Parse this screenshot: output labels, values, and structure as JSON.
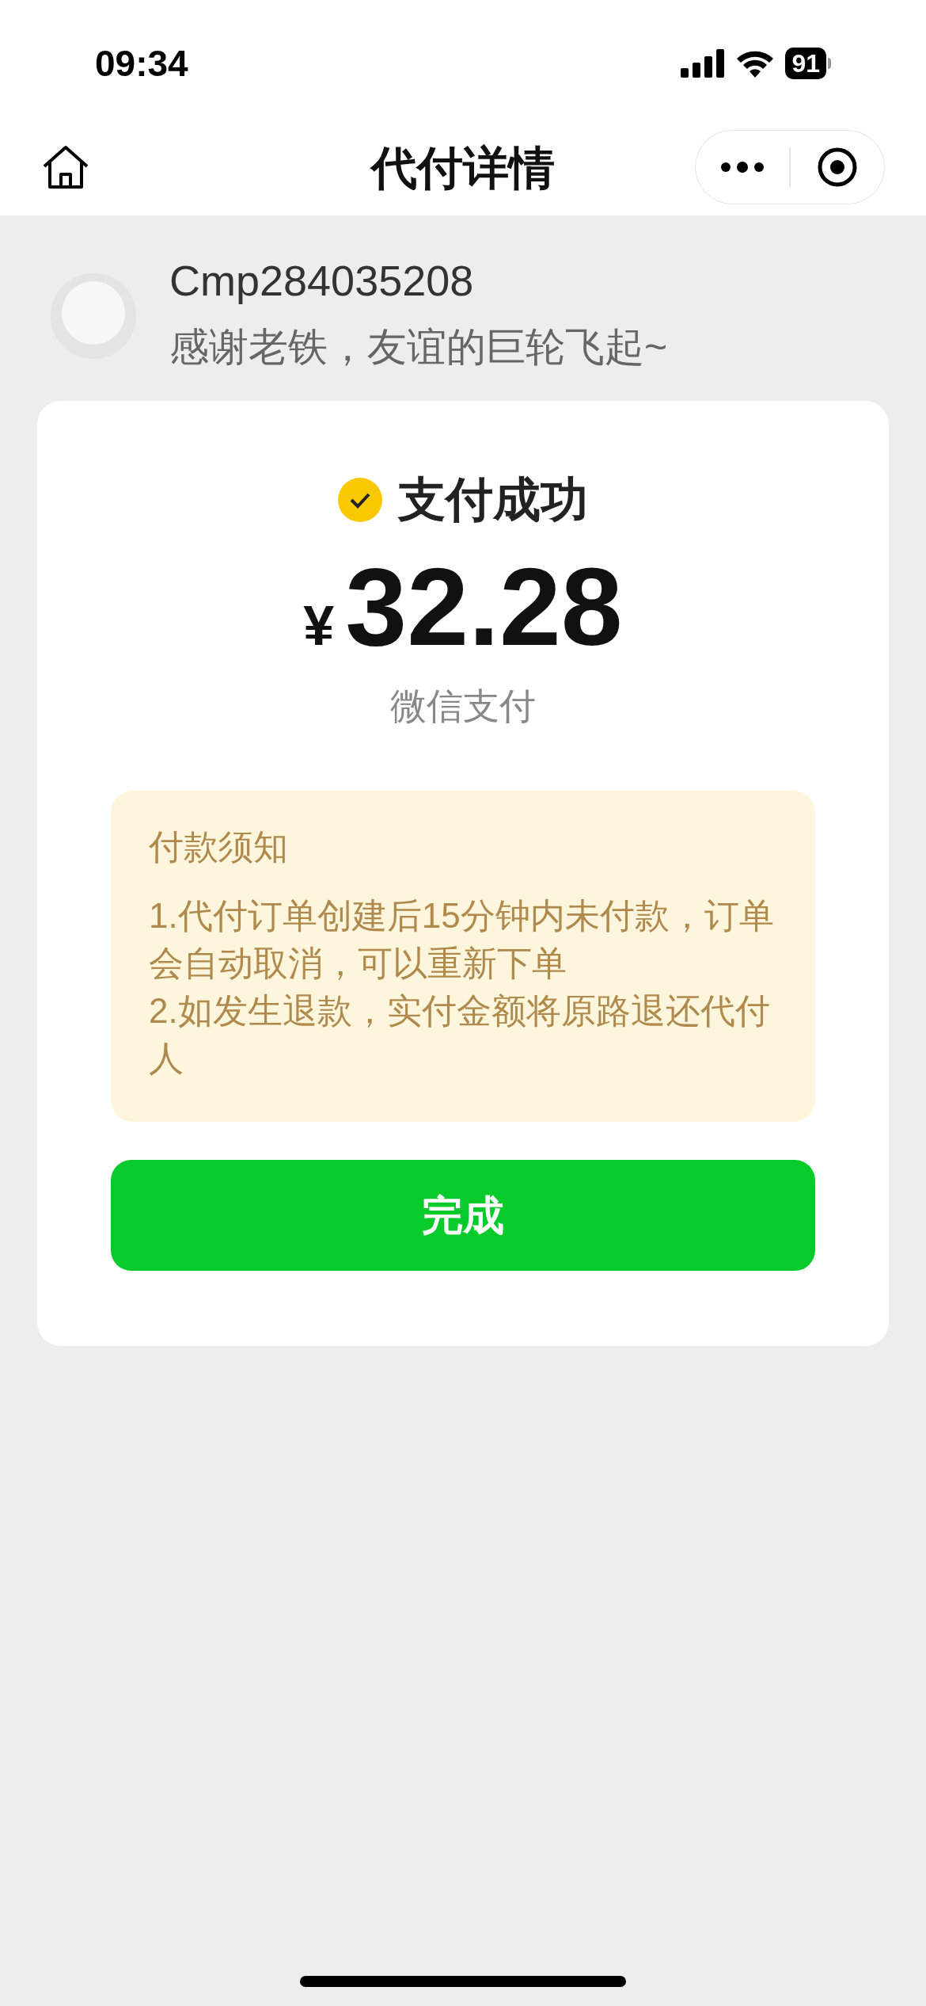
{
  "status_bar": {
    "time": "09:34",
    "battery": "91"
  },
  "nav": {
    "title": "代付详情"
  },
  "payer": {
    "name": "Cmp284035208",
    "message": "感谢老铁，友谊的巨轮飞起~"
  },
  "result": {
    "status": "支付成功",
    "currency": "¥",
    "amount": "32.28",
    "method": "微信支付"
  },
  "notice": {
    "title": "付款须知",
    "lines": [
      "1.代付订单创建后15分钟内未付款，订单会自动取消，可以重新下单",
      "2.如发生退款，实付金额将原路退还代付人"
    ]
  },
  "button": "完成"
}
